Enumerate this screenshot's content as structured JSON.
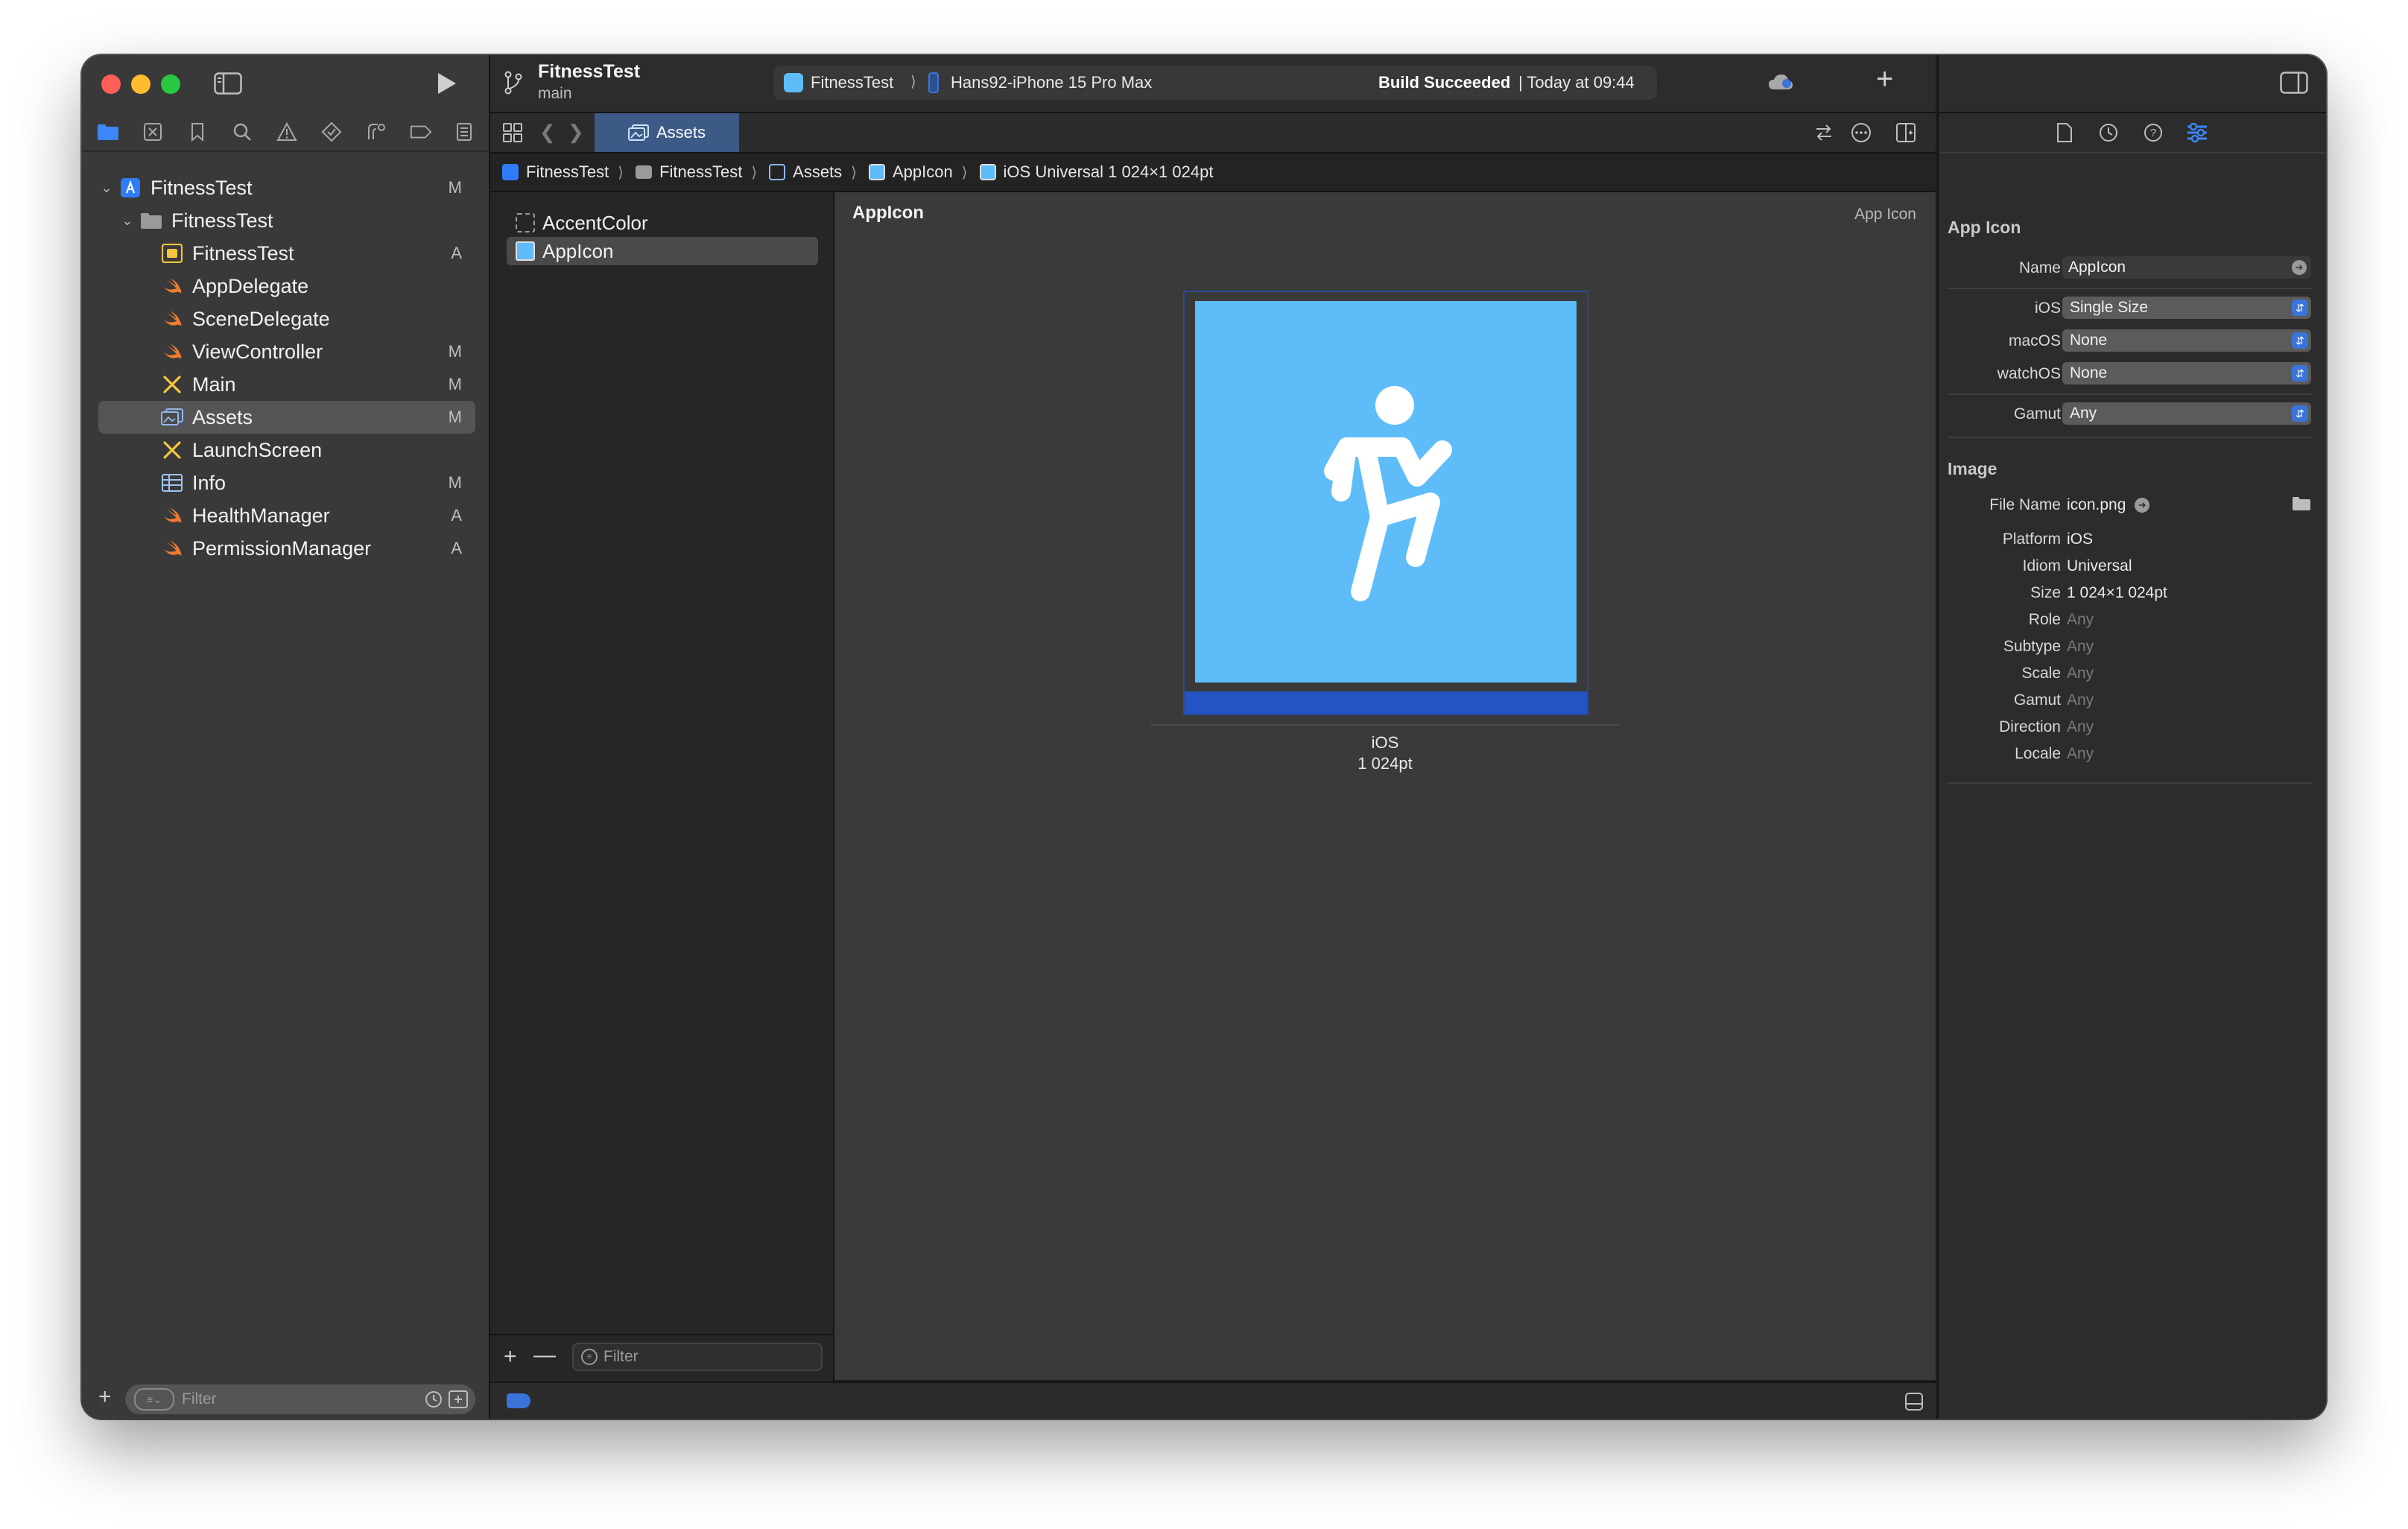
{
  "window": {
    "project": "FitnessTest",
    "branch": "main",
    "scheme": "FitnessTest",
    "device": "Hans92-iPhone 15 Pro Max",
    "build_status_strong": "Build Succeeded",
    "build_status_time": "| Today at 09:44"
  },
  "navigator": {
    "rows": [
      {
        "label": "FitnessTest",
        "badge": "M",
        "icon": "project-icon"
      },
      {
        "label": "FitnessTest",
        "badge": "",
        "icon": "folder-icon"
      },
      {
        "label": "FitnessTest",
        "badge": "A",
        "icon": "entitlements-icon"
      },
      {
        "label": "AppDelegate",
        "badge": "",
        "icon": "swift-icon"
      },
      {
        "label": "SceneDelegate",
        "badge": "",
        "icon": "swift-icon"
      },
      {
        "label": "ViewController",
        "badge": "M",
        "icon": "swift-icon"
      },
      {
        "label": "Main",
        "badge": "M",
        "icon": "storyboard-icon"
      },
      {
        "label": "Assets",
        "badge": "M",
        "icon": "assets-icon"
      },
      {
        "label": "LaunchScreen",
        "badge": "",
        "icon": "storyboard-icon"
      },
      {
        "label": "Info",
        "badge": "M",
        "icon": "plist-icon"
      },
      {
        "label": "HealthManager",
        "badge": "A",
        "icon": "swift-icon"
      },
      {
        "label": "PermissionManager",
        "badge": "A",
        "icon": "swift-icon"
      }
    ],
    "filter_placeholder": "Filter"
  },
  "tab": {
    "label": "Assets"
  },
  "jumpbar": [
    "FitnessTest",
    "FitnessTest",
    "Assets",
    "AppIcon",
    "iOS Universal 1 024×1 024pt"
  ],
  "assets": {
    "items": [
      "AccentColor",
      "AppIcon"
    ],
    "filter_placeholder": "Filter"
  },
  "canvas": {
    "title": "AppIcon",
    "type_label": "App Icon",
    "slot_platform": "iOS",
    "slot_size": "1 024pt",
    "icon_bg_color": "#5ebdf9"
  },
  "inspector": {
    "section_app_icon": "App Icon",
    "name_label": "Name",
    "name_value": "AppIcon",
    "ios_label": "iOS",
    "ios_value": "Single Size",
    "macos_label": "macOS",
    "macos_value": "None",
    "watchos_label": "watchOS",
    "watchos_value": "None",
    "gamut_label": "Gamut",
    "gamut_value": "Any",
    "section_image": "Image",
    "filename_label": "File Name",
    "filename_value": "icon.png",
    "props": [
      {
        "label": "Platform",
        "value": "iOS",
        "dim": false
      },
      {
        "label": "Idiom",
        "value": "Universal",
        "dim": false
      },
      {
        "label": "Size",
        "value": "1 024×1 024pt",
        "dim": false
      },
      {
        "label": "Role",
        "value": "Any",
        "dim": true
      },
      {
        "label": "Subtype",
        "value": "Any",
        "dim": true
      },
      {
        "label": "Scale",
        "value": "Any",
        "dim": true
      },
      {
        "label": "Gamut",
        "value": "Any",
        "dim": true
      },
      {
        "label": "Direction",
        "value": "Any",
        "dim": true
      },
      {
        "label": "Locale",
        "value": "Any",
        "dim": true
      }
    ]
  }
}
